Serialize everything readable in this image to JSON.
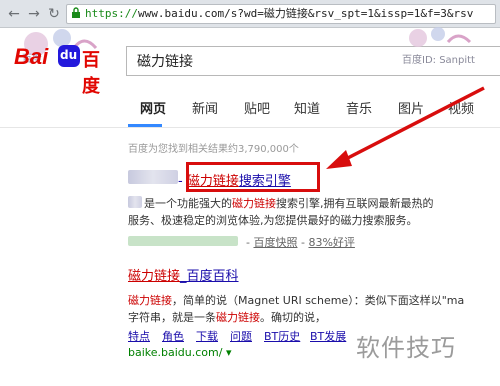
{
  "browser": {
    "url_scheme": "https://",
    "url_rest": "www.baidu.com/s?wd=磁力链接&rsv_spt=1&issp=1&f=3&rsv"
  },
  "header": {
    "logo_text_latin": "Bai",
    "logo_text_du": "du",
    "logo_text_cn": "百度",
    "search_value": "磁力链接",
    "watermark_text": "百度ID: Sanpitt",
    "left_watermark_text": "百度"
  },
  "tabs": [
    {
      "label": "网页"
    },
    {
      "label": "新闻"
    },
    {
      "label": "贴吧"
    },
    {
      "label": "知道"
    },
    {
      "label": "音乐"
    },
    {
      "label": "图片"
    },
    {
      "label": "视频"
    }
  ],
  "stats_text": "百度为您找到相关结果约3,790,000个",
  "results": [
    {
      "title_red": "磁力链接",
      "title_blue": "搜索引擎",
      "title_sep": " - ",
      "line1_prefix": "是一个功能强大的",
      "line1_red": "磁力链接",
      "line1_suffix": "搜索引擎,拥有互联网最新最热的",
      "line2": "服务、极速稳定的浏览体验,为您提供最好的磁力搜索服务。",
      "meta_sep": "-",
      "meta_snapshot": "百度快照",
      "meta_sep2": "-",
      "meta_rating": "83%好评"
    },
    {
      "title_red": "磁力链接",
      "title_blue": "_百度百科",
      "line1_red": "磁力链接",
      "line1_text": "，简单的说（Magnet URI scheme）：类似下面这样以\"ma",
      "line2_prefix": "字符串，就是一条",
      "line2_red": "磁力链接",
      "line2_suffix": "。确切的说，",
      "sublinks": [
        "特点",
        "角色",
        "下载",
        "问题",
        "BT历史",
        "BT发展"
      ],
      "url": "baike.baidu.com/",
      "url_caret": "▾"
    }
  ],
  "watermark_bottom": "软件技巧",
  "colors": {
    "accent_red": "#d80d0d",
    "link_blue": "#1a0dab",
    "baidu_blue": "#2319dc",
    "tab_underline": "#3388ff"
  }
}
